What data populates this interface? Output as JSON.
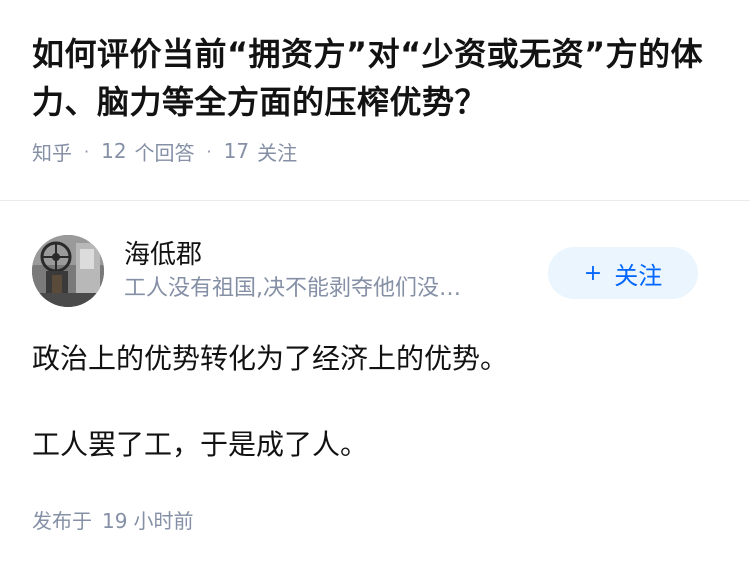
{
  "question": {
    "title": "如何评价当前“拥资方”对“少资或无资”方的体力、脑力等全方面的压榨优势？",
    "source": "知乎",
    "answers_count": "12",
    "answers_label": "个回答",
    "followers_count": "17",
    "followers_label": "关注"
  },
  "answer": {
    "author": {
      "name": "海低郡",
      "bio": "工人没有祖国,决不能剥夺他们没…",
      "avatar_icon": "avatar-photo-icon"
    },
    "follow_button": {
      "icon": "plus-icon",
      "icon_glyph": "+",
      "label": "关注"
    },
    "paragraphs": [
      "政治上的优势转化为了经济上的优势。",
      "工人罢了工，于是成了人。"
    ],
    "publish": {
      "prefix": "发布于",
      "number": "19",
      "unit": "小时前"
    }
  },
  "colors": {
    "text_primary": "#121212",
    "text_secondary": "#8590a6",
    "accent": "#0066ff",
    "accent_bg": "#ebf5fd",
    "divider": "#ebebeb"
  }
}
